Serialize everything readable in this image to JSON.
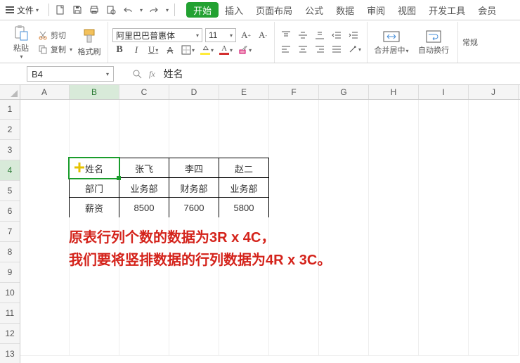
{
  "menu": {
    "file": "文件",
    "tabs": [
      "开始",
      "插入",
      "页面布局",
      "公式",
      "数据",
      "审阅",
      "视图",
      "开发工具",
      "会员"
    ]
  },
  "qat_icons": [
    "new-doc-icon",
    "save-icon",
    "print-icon",
    "print-preview-icon",
    "undo-icon",
    "redo-icon"
  ],
  "ribbon": {
    "paste": "粘贴",
    "cut": "剪切",
    "copy": "复制",
    "format_painter": "格式刷",
    "font_name": "阿里巴巴普惠体",
    "font_size": "11",
    "merge_center": "合并居中",
    "wrap_text": "自动换行",
    "general": "常规"
  },
  "namebox": "B4",
  "formula_value": "姓名",
  "columns": [
    "A",
    "B",
    "C",
    "D",
    "E",
    "F",
    "G",
    "H",
    "I",
    "J"
  ],
  "rows": [
    "1",
    "2",
    "3",
    "4",
    "5",
    "6",
    "7",
    "8",
    "9",
    "10",
    "11",
    "12",
    "13"
  ],
  "selected_col": "B",
  "selected_row": "4",
  "table": {
    "r1": [
      "姓名",
      "张飞",
      "李四",
      "赵二"
    ],
    "r2": [
      "部门",
      "业务部",
      "财务部",
      "业务部"
    ],
    "r3": [
      "薪资",
      "8500",
      "7600",
      "5800"
    ]
  },
  "annotation": {
    "line1": "原表行列个数的数据为3R x 4C，",
    "line2": "我们要将竖排数据的行列数据为4R x 3C。"
  },
  "chart_data": {
    "type": "table",
    "headers": [
      "姓名",
      "张飞",
      "李四",
      "赵二"
    ],
    "rows": [
      [
        "部门",
        "业务部",
        "财务部",
        "业务部"
      ],
      [
        "薪资",
        8500,
        7600,
        5800
      ]
    ]
  }
}
